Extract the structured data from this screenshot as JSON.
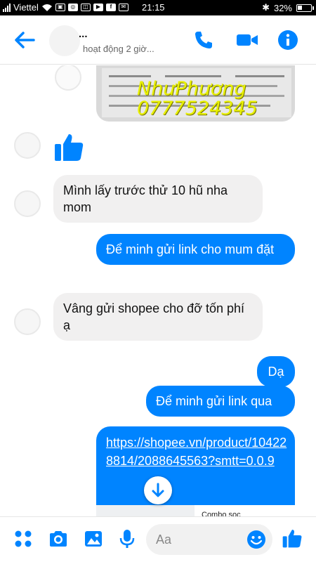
{
  "status_bar": {
    "carrier": "Viettel",
    "time": "21:15",
    "battery": "32%",
    "battery_level": 0.32
  },
  "header": {
    "name": "...",
    "subtitle": "hoạt động 2 giờ...",
    "accent_color": "#0084ff"
  },
  "photo": {
    "watermark_name": "NhưPhương",
    "watermark_phone": "0777524345"
  },
  "messages": [
    {
      "side": "in",
      "kind": "like-icon"
    },
    {
      "side": "in",
      "text": "Mình lấy trước thử 10 hũ nha mom"
    },
    {
      "side": "out",
      "text": "Để minh gửi link cho mum đặt"
    },
    {
      "side": "in",
      "text": "Vâng gửi shopee cho đỡ tốn phí ạ"
    },
    {
      "side": "out",
      "text": "Dạ"
    },
    {
      "side": "out",
      "text": "Để minh gửi link qua"
    }
  ],
  "link_message": {
    "url": "https://shopee.vn/product/104228814/2088645563?smtt=0.0.9",
    "preview_title": "Combo soc"
  },
  "composer": {
    "placeholder": "Aa"
  },
  "colors": {
    "outgoing": "#0084ff",
    "incoming": "#f1f0f0"
  }
}
